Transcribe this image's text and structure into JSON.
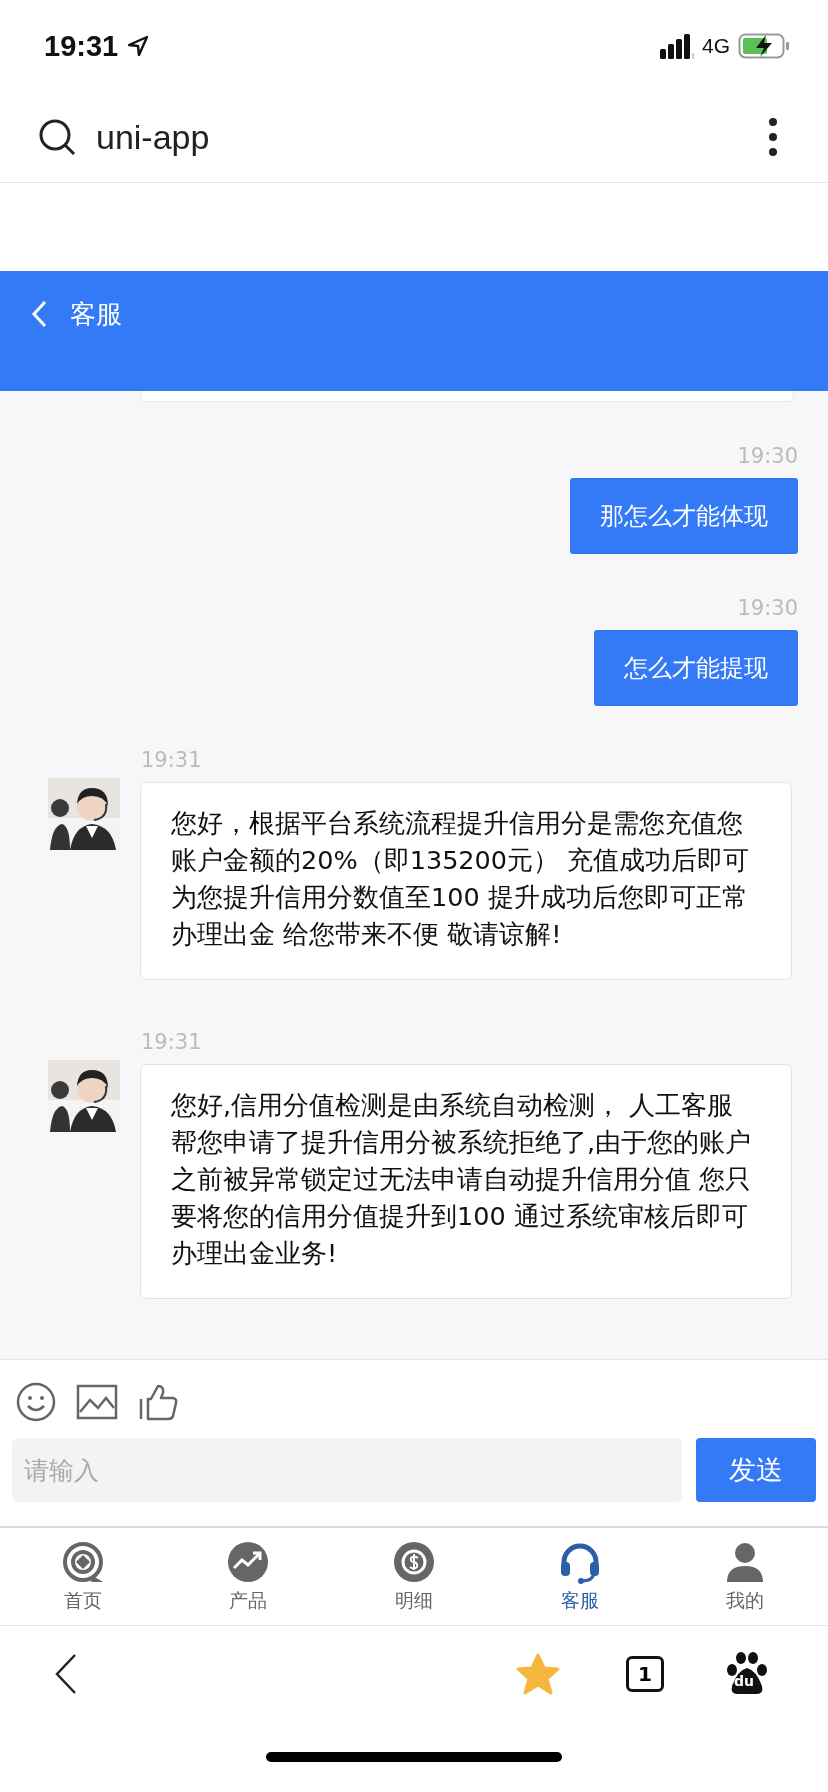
{
  "status_bar": {
    "time": "19:31",
    "network": "4G"
  },
  "browser_bar": {
    "title": "uni-app"
  },
  "header": {
    "title": "客服"
  },
  "messages": [
    {
      "kind": "sent",
      "time": "19:30",
      "text": "那怎么才能体现"
    },
    {
      "kind": "sent",
      "time": "19:30",
      "text": "怎么才能提现"
    },
    {
      "kind": "received",
      "time": "19:31",
      "text": "您好，根据平台系统流程提升信用分是需您充值您账户金额的20%（即135200元） 充值成功后即可为您提升信用分数值至100 提升成功后您即可正常办理出金 给您带来不便 敬请谅解!"
    },
    {
      "kind": "received",
      "time": "19:31",
      "text": "您好,信用分值检测是由系统自动检测， 人工客服帮您申请了提升信用分被系统拒绝了,由于您的账户之前被异常锁定过无法申请自动提升信用分值 您只要将您的信用分值提升到100 通过系统审核后即可办理出金业务!"
    }
  ],
  "composer": {
    "placeholder": "请输入",
    "send": "发送"
  },
  "tabs": [
    {
      "label": "首页",
      "selected": false
    },
    {
      "label": "产品",
      "selected": false
    },
    {
      "label": "明细",
      "selected": false
    },
    {
      "label": "客服",
      "selected": true
    },
    {
      "label": "我的",
      "selected": false
    }
  ],
  "browser_toolbar": {
    "tab_count": "1",
    "logo_text": "du"
  }
}
